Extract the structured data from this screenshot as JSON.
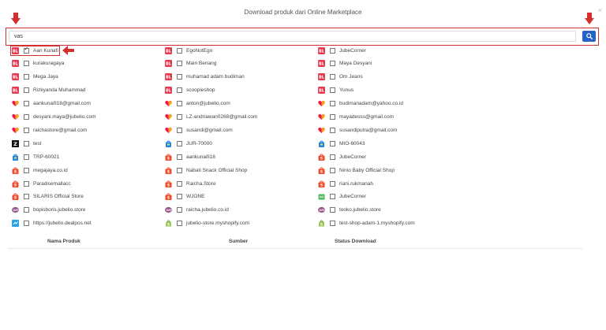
{
  "modal": {
    "title": "Download produk dari Online Marketplace",
    "close_symbol": "×"
  },
  "search": {
    "value": "vas",
    "button_icon": "search-icon"
  },
  "colors": {
    "highlight_red": "#d32f2f",
    "search_button_blue": "#2563c9",
    "blibli_red": "#e53950",
    "tokopedia_green": "#42b549",
    "shopee_orange": "#ee4d2d",
    "lazada_pink": "#f5114b"
  },
  "stores": [
    [
      {
        "label": "Aan Kunafi",
        "icon": "bl",
        "checked": true
      },
      {
        "label": "kurakuragaya",
        "icon": "bl",
        "checked": false
      },
      {
        "label": "Mega Jaya",
        "icon": "bl",
        "checked": false
      },
      {
        "label": "Rizkyanda Muhammad",
        "icon": "bl",
        "checked": false
      },
      {
        "label": "aankunaifi18@gmail.com",
        "icon": "lazada",
        "checked": false
      },
      {
        "label": "desyani.maya@jubelio.com",
        "icon": "lazada",
        "checked": false
      },
      {
        "label": "raichastore@gmail.com",
        "icon": "lazada",
        "checked": false
      },
      {
        "label": "test",
        "icon": "z",
        "checked": false
      },
      {
        "label": "TRP-60021",
        "icon": "blue-bag",
        "checked": false
      },
      {
        "label": "megajaya.co.id",
        "icon": "shopee",
        "checked": false
      },
      {
        "label": "Paradisemallacc",
        "icon": "shopee",
        "checked": false
      },
      {
        "label": "SILARIS Official Store",
        "icon": "shopee",
        "checked": false
      },
      {
        "label": "bopisboris.jubelio.store",
        "icon": "woo",
        "checked": false
      },
      {
        "label": "https://jubelio.dealpos.net",
        "icon": "dealpos",
        "checked": false
      }
    ],
    [
      {
        "label": "EgoNotEgo",
        "icon": "bl",
        "checked": false
      },
      {
        "label": "Main Benang",
        "icon": "bl",
        "checked": false
      },
      {
        "label": "muhamad adam budiman",
        "icon": "bl",
        "checked": false
      },
      {
        "label": "scoopieshop",
        "icon": "bl",
        "checked": false
      },
      {
        "label": "anton@jubelio.com",
        "icon": "lazada",
        "checked": false
      },
      {
        "label": "LZ-andriawan0268@gmail.com",
        "icon": "lazada",
        "checked": false
      },
      {
        "label": "susandi@gmail.com",
        "icon": "lazada",
        "checked": false
      },
      {
        "label": "JUR-70000",
        "icon": "blue-bag",
        "checked": false
      },
      {
        "label": "aankunaifi18",
        "icon": "shopee",
        "checked": false
      },
      {
        "label": "Nabati Snack Official Shop",
        "icon": "shopee",
        "checked": false
      },
      {
        "label": "Raicha.Store",
        "icon": "shopee",
        "checked": false
      },
      {
        "label": "WJONE",
        "icon": "shopee",
        "checked": false
      },
      {
        "label": "raicha.jubelio.co.id",
        "icon": "woo",
        "checked": false
      },
      {
        "label": "jubelio-store.myshopify.com",
        "icon": "shopify",
        "checked": false
      }
    ],
    [
      {
        "label": "JubeCorner",
        "icon": "bl",
        "checked": false
      },
      {
        "label": "Maya Desyani",
        "icon": "bl",
        "checked": false
      },
      {
        "label": "Om Jeans",
        "icon": "bl",
        "checked": false
      },
      {
        "label": "Yunus",
        "icon": "bl",
        "checked": false
      },
      {
        "label": "budimanadam@yahoo.co.id",
        "icon": "lazada",
        "checked": false
      },
      {
        "label": "mayadesss@gmail.com",
        "icon": "lazada",
        "checked": false
      },
      {
        "label": "susandiputra@gmail.com",
        "icon": "lazada",
        "checked": false
      },
      {
        "label": "MIO-60043",
        "icon": "blue-bag",
        "checked": false
      },
      {
        "label": "JubeCorner",
        "icon": "shopee",
        "checked": false
      },
      {
        "label": "Ninio Baby Official Shop",
        "icon": "shopee",
        "checked": false
      },
      {
        "label": "riani.rukmanah",
        "icon": "shopee",
        "checked": false
      },
      {
        "label": "JubeCorner",
        "icon": "tokopedia",
        "checked": false
      },
      {
        "label": "tooko.jubelio.store",
        "icon": "woo",
        "checked": false
      },
      {
        "label": "test-shop-adam-1.myshopify.com",
        "icon": "shopify",
        "checked": false
      }
    ]
  ],
  "table": {
    "columns": [
      "Nama Produk",
      "Sumber",
      "Status Download"
    ]
  }
}
